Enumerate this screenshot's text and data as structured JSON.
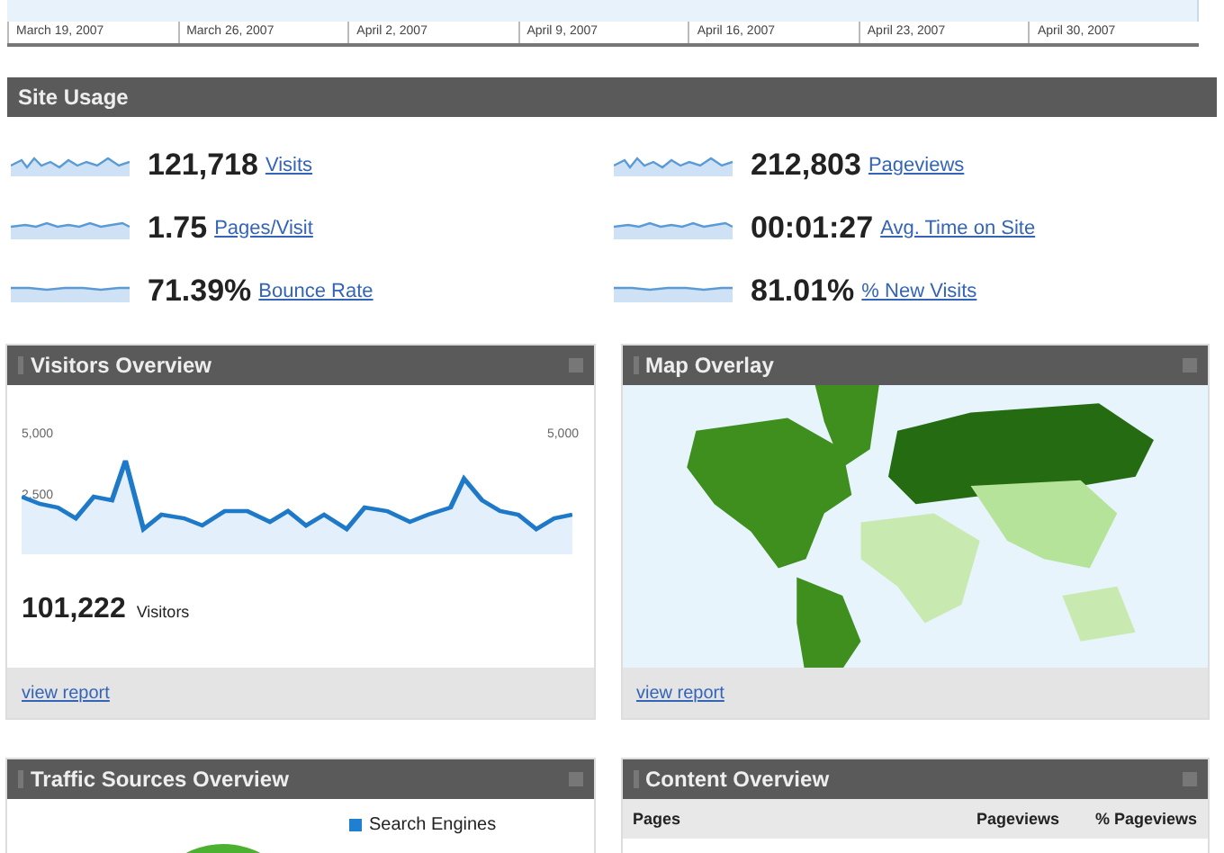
{
  "timeline": {
    "dates": [
      "March 19, 2007",
      "March 26, 2007",
      "April 2, 2007",
      "April 9, 2007",
      "April 16, 2007",
      "April 23, 2007",
      "April 30, 2007"
    ]
  },
  "site_usage": {
    "title": "Site Usage",
    "metrics": [
      {
        "value": "121,718",
        "label": "Visits"
      },
      {
        "value": "212,803",
        "label": "Pageviews"
      },
      {
        "value": "1.75",
        "label": "Pages/Visit"
      },
      {
        "value": "00:01:27",
        "label": "Avg. Time on Site"
      },
      {
        "value": "71.39%",
        "label": "Bounce Rate"
      },
      {
        "value": "81.01%",
        "label": "% New Visits"
      }
    ]
  },
  "visitors_overview": {
    "title": "Visitors Overview",
    "y_labels": [
      "5,000",
      "2,500"
    ],
    "right_labels": [
      "5,000"
    ],
    "total": "101,222",
    "total_label": "Visitors",
    "link": "view report"
  },
  "map_overlay": {
    "title": "Map Overlay",
    "link": "view report"
  },
  "traffic_sources": {
    "title": "Traffic Sources Overview",
    "legend": [
      {
        "label": "Search Engines",
        "color": "#1f7fd0"
      }
    ]
  },
  "content_overview": {
    "title": "Content Overview",
    "columns": [
      "Pages",
      "Pageviews",
      "% Pageviews"
    ]
  }
}
